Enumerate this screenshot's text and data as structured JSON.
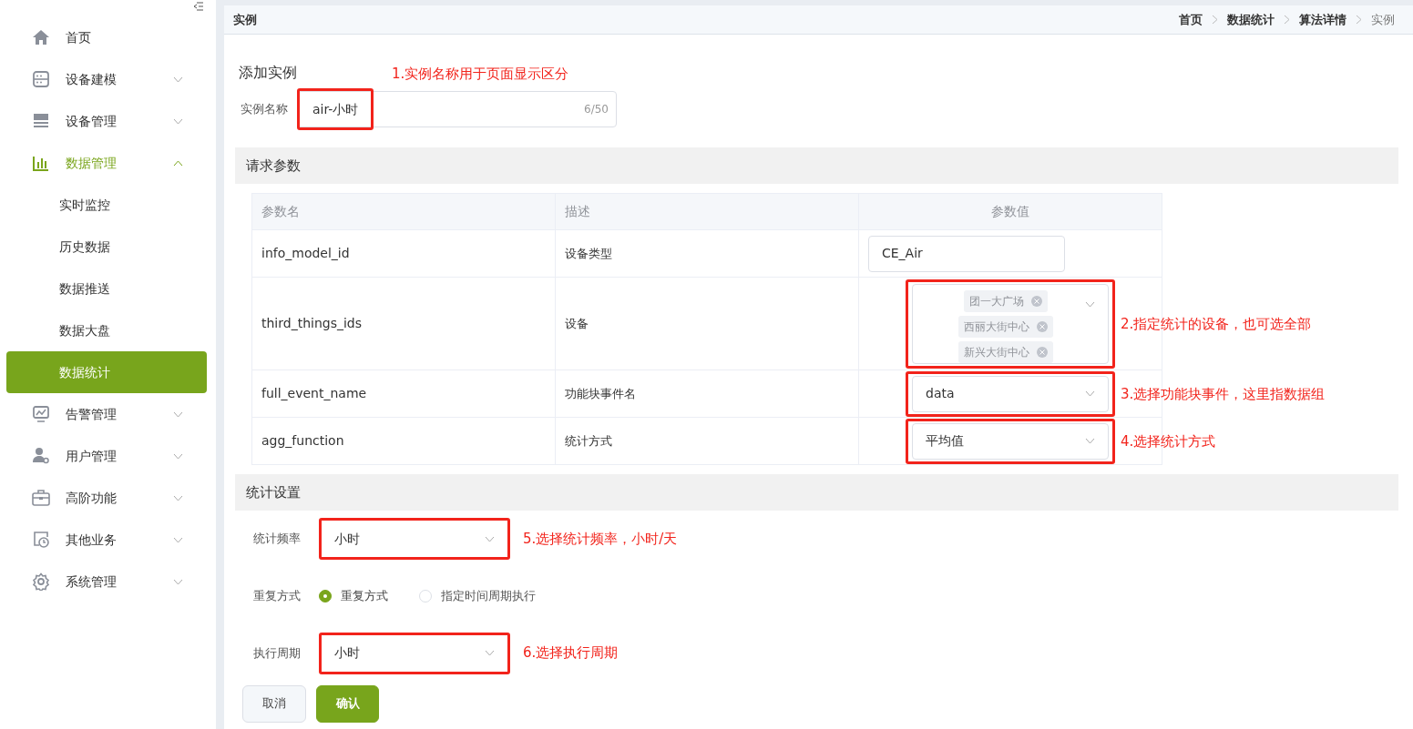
{
  "sidebar": {
    "items": [
      {
        "label": "首页",
        "selected": false
      },
      {
        "label": "设备建模",
        "expanded": false,
        "selected": false
      },
      {
        "label": "设备管理",
        "expanded": false,
        "selected": false
      },
      {
        "label": "数据管理",
        "expanded": true,
        "selected": false,
        "children": [
          {
            "label": "实时监控",
            "selected": false
          },
          {
            "label": "历史数据",
            "selected": false
          },
          {
            "label": "数据推送",
            "selected": false
          },
          {
            "label": "数据大盘",
            "selected": false
          },
          {
            "label": "数据统计",
            "selected": true
          }
        ]
      },
      {
        "label": "告警管理",
        "expanded": false,
        "selected": false
      },
      {
        "label": "用户管理",
        "expanded": false,
        "selected": false
      },
      {
        "label": "高阶功能",
        "expanded": false,
        "selected": false
      },
      {
        "label": "其他业务",
        "expanded": false,
        "selected": false
      },
      {
        "label": "系统管理",
        "expanded": false,
        "selected": false
      }
    ]
  },
  "header": {
    "title": "实例",
    "breadcrumb": [
      {
        "label": "首页",
        "current": false
      },
      {
        "label": "数据统计",
        "current": false
      },
      {
        "label": "算法详情",
        "current": false
      },
      {
        "label": "实例",
        "current": true
      }
    ]
  },
  "form": {
    "title": "添加实例",
    "name_label": "实例名称",
    "name_value": "air-小时",
    "name_counter": "6/50",
    "annotation": "1.实例名称用于页面显示区分"
  },
  "request_section": {
    "title": "请求参数",
    "columns": [
      "参数名",
      "描述",
      "参数值"
    ],
    "rows": [
      {
        "name": "info_model_id",
        "description": "设备类型",
        "kind": "input",
        "value": "CE_Air"
      },
      {
        "name": "third_things_ids",
        "description": "设备",
        "kind": "tags",
        "tags": [
          "团一大广场",
          "西丽大街中心",
          "新兴大街中心"
        ],
        "annotation": "2.指定统计的设备，也可选全部"
      },
      {
        "name": "full_event_name",
        "description": "功能块事件名",
        "kind": "select",
        "value": "data",
        "annotation": "3.选择功能块事件，这里指数据组"
      },
      {
        "name": "agg_function",
        "description": "统计方式",
        "kind": "select",
        "value": "平均值",
        "annotation": "4.选择统计方式"
      }
    ]
  },
  "stats_section": {
    "title": "统计设置",
    "frequency": {
      "label": "统计频率",
      "value": "小时",
      "annotation": "5.选择统计频率，小时/天"
    },
    "repeat": {
      "label": "重复方式",
      "options": [
        {
          "label": "重复方式",
          "selected": true
        },
        {
          "label": "指定时间周期执行",
          "selected": false
        }
      ]
    },
    "period": {
      "label": "执行周期",
      "value": "小时",
      "annotation": "6.选择执行周期"
    }
  },
  "buttons": [
    {
      "label": "取消",
      "kind": "secondary"
    },
    {
      "label": "确认",
      "kind": "primary"
    }
  ]
}
